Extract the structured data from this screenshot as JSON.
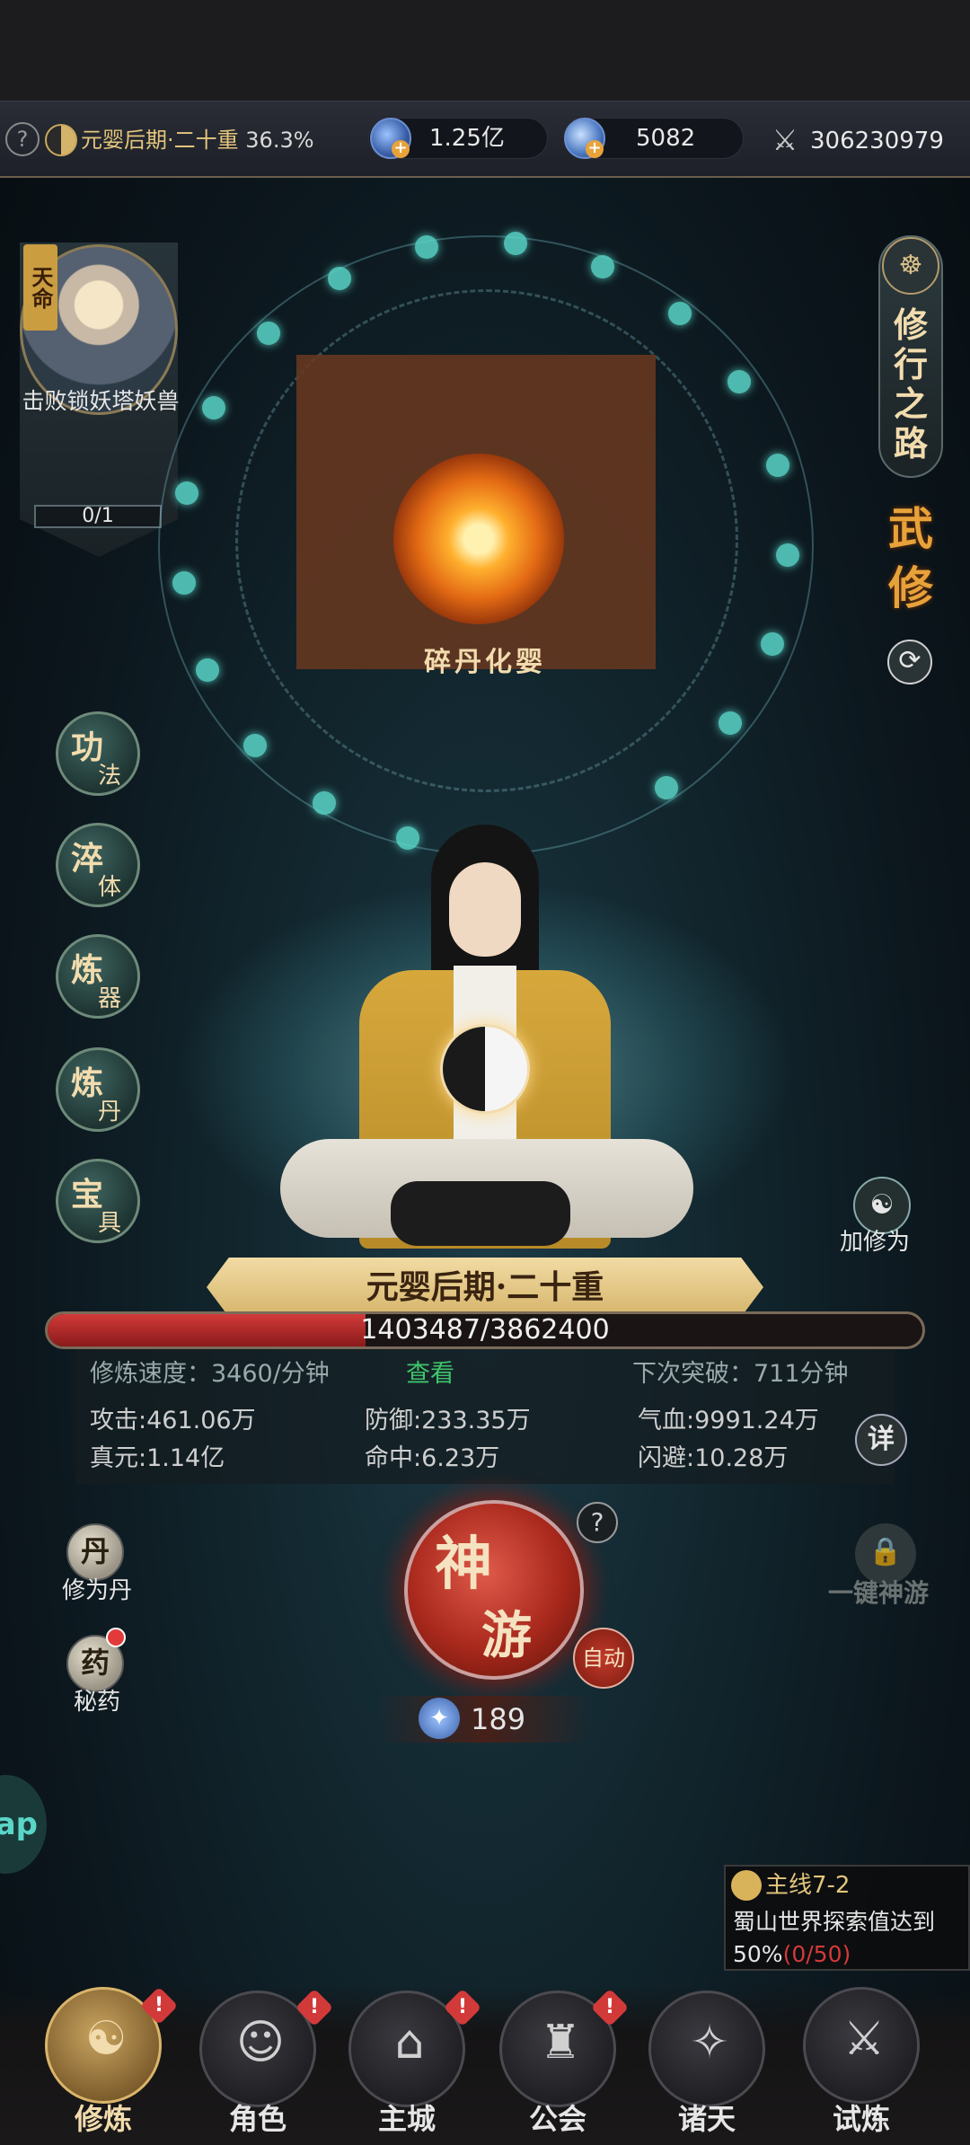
{
  "top_bar": {
    "help_glyph": "?",
    "realm_name": "元婴后期·二十重",
    "realm_progress": "36.3%",
    "spirit_stones": "1.25亿",
    "gems": "5082",
    "combat_power": "306230979"
  },
  "quest_card": {
    "badge": "天命",
    "task": "击败锁妖塔妖兽",
    "progress": "0/1"
  },
  "magic_circle": {
    "core_label": "碎丹化婴"
  },
  "cultivation_path": {
    "title": "修行之路",
    "mode": "武修"
  },
  "skills": [
    {
      "big": "功",
      "small": "法"
    },
    {
      "big": "淬",
      "small": "体"
    },
    {
      "big": "炼",
      "small": "器"
    },
    {
      "big": "炼",
      "small": "丹"
    },
    {
      "big": "宝",
      "small": "具"
    }
  ],
  "add_cultivation": {
    "label": "加修为"
  },
  "realm_banner": "元婴后期·二十重",
  "experience": {
    "text": "1403487/3862400",
    "fraction": 0.363
  },
  "stats": {
    "speed_label": "修炼速度：",
    "speed_value": "3460/分钟",
    "see_link": "查看",
    "breakthrough": "下次突破：711分钟",
    "attack": "攻击:461.06万",
    "defense": "防御:233.35万",
    "hp": "气血:9991.24万",
    "true_essence": "真元:1.14亿",
    "hit": "命中:6.23万",
    "dodge": "闪避:10.28万",
    "detail_label": "详"
  },
  "items": [
    {
      "icon_char": "丹",
      "label": "修为丹"
    },
    {
      "icon_char": "药",
      "label": "秘药"
    }
  ],
  "shenyou": {
    "char1": "神",
    "char2": "游",
    "help": "?",
    "auto_label": "自动",
    "count": "189"
  },
  "one_click": {
    "label": "一键神游"
  },
  "app_edge_text": "ap",
  "main_quest": {
    "title": "主线7-2",
    "desc": "蜀山世界探索值达到",
    "target": "50%",
    "progress": "(0/50)"
  },
  "bottom_nav": [
    {
      "label": "修炼",
      "glyph": "☯",
      "alert": "!"
    },
    {
      "label": "角色",
      "glyph": "☺",
      "alert": "!"
    },
    {
      "label": "主城",
      "glyph": "⌂",
      "alert": "!"
    },
    {
      "label": "公会",
      "glyph": "♜",
      "alert": "!"
    },
    {
      "label": "诸天",
      "glyph": "✧"
    },
    {
      "label": "试炼",
      "glyph": "⚔"
    }
  ],
  "colors": {
    "gold": "#e3c57c",
    "accent_orange": "#e8a23a",
    "exp_red": "#d23a3a",
    "link_green": "#3fc46a",
    "node_teal": "#5ad6c8"
  }
}
